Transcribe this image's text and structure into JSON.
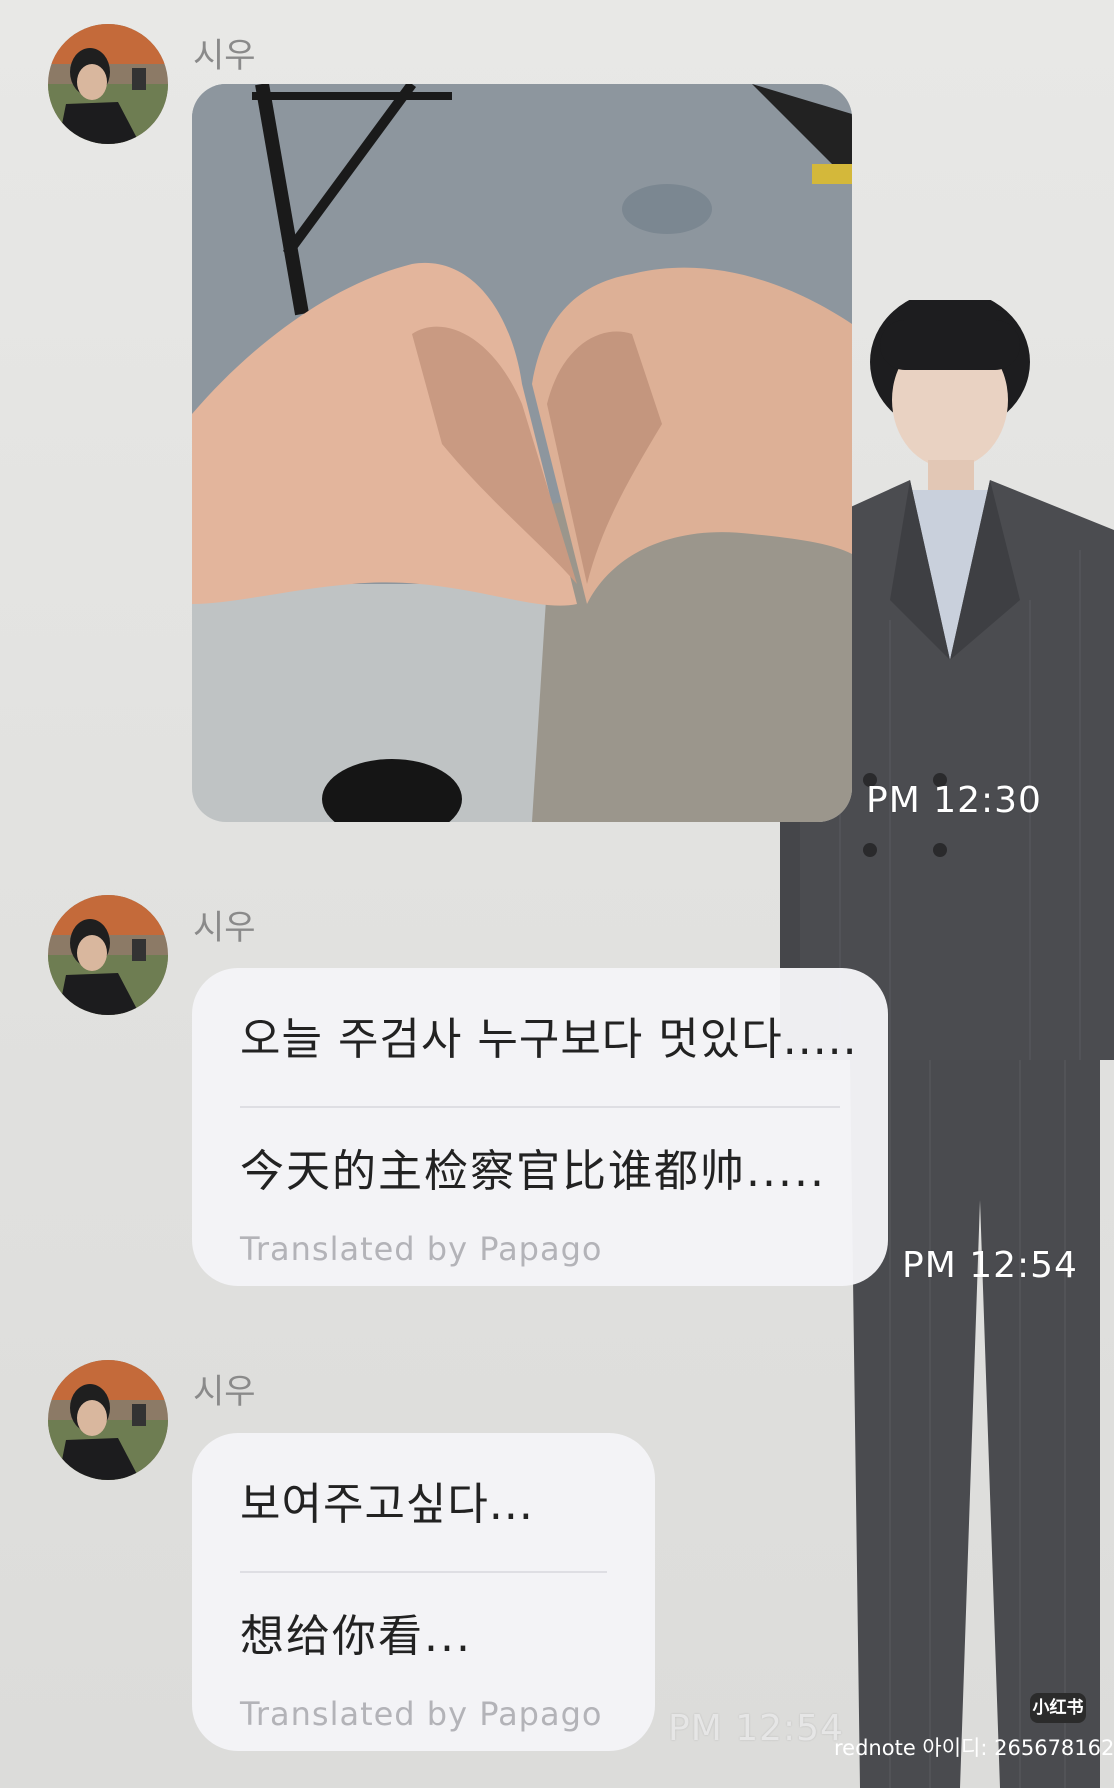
{
  "messages": [
    {
      "sender": "시우",
      "type": "photo",
      "photo_description_icon": "heart-hands-photo",
      "time": "PM 12:30"
    },
    {
      "sender": "시우",
      "type": "text",
      "original": "오늘 주검사 누구보다 멋있다.....",
      "translated": "今天的主检察官比谁都帅.....",
      "credit": "Translated by Papago",
      "time": "PM 12:54"
    },
    {
      "sender": "시우",
      "type": "text",
      "original": "보여주고싶다...",
      "translated": "想给你看...",
      "credit": "Translated by Papago",
      "time": "PM 12:54"
    }
  ],
  "watermark": {
    "badge": "小红书",
    "text": "rednote 아이디: 265678162"
  },
  "colors": {
    "bubble": "#f4f4f7",
    "background": "#e2e2e0",
    "sender_name": "#8a8a8a",
    "timestamp": "#ffffff"
  }
}
